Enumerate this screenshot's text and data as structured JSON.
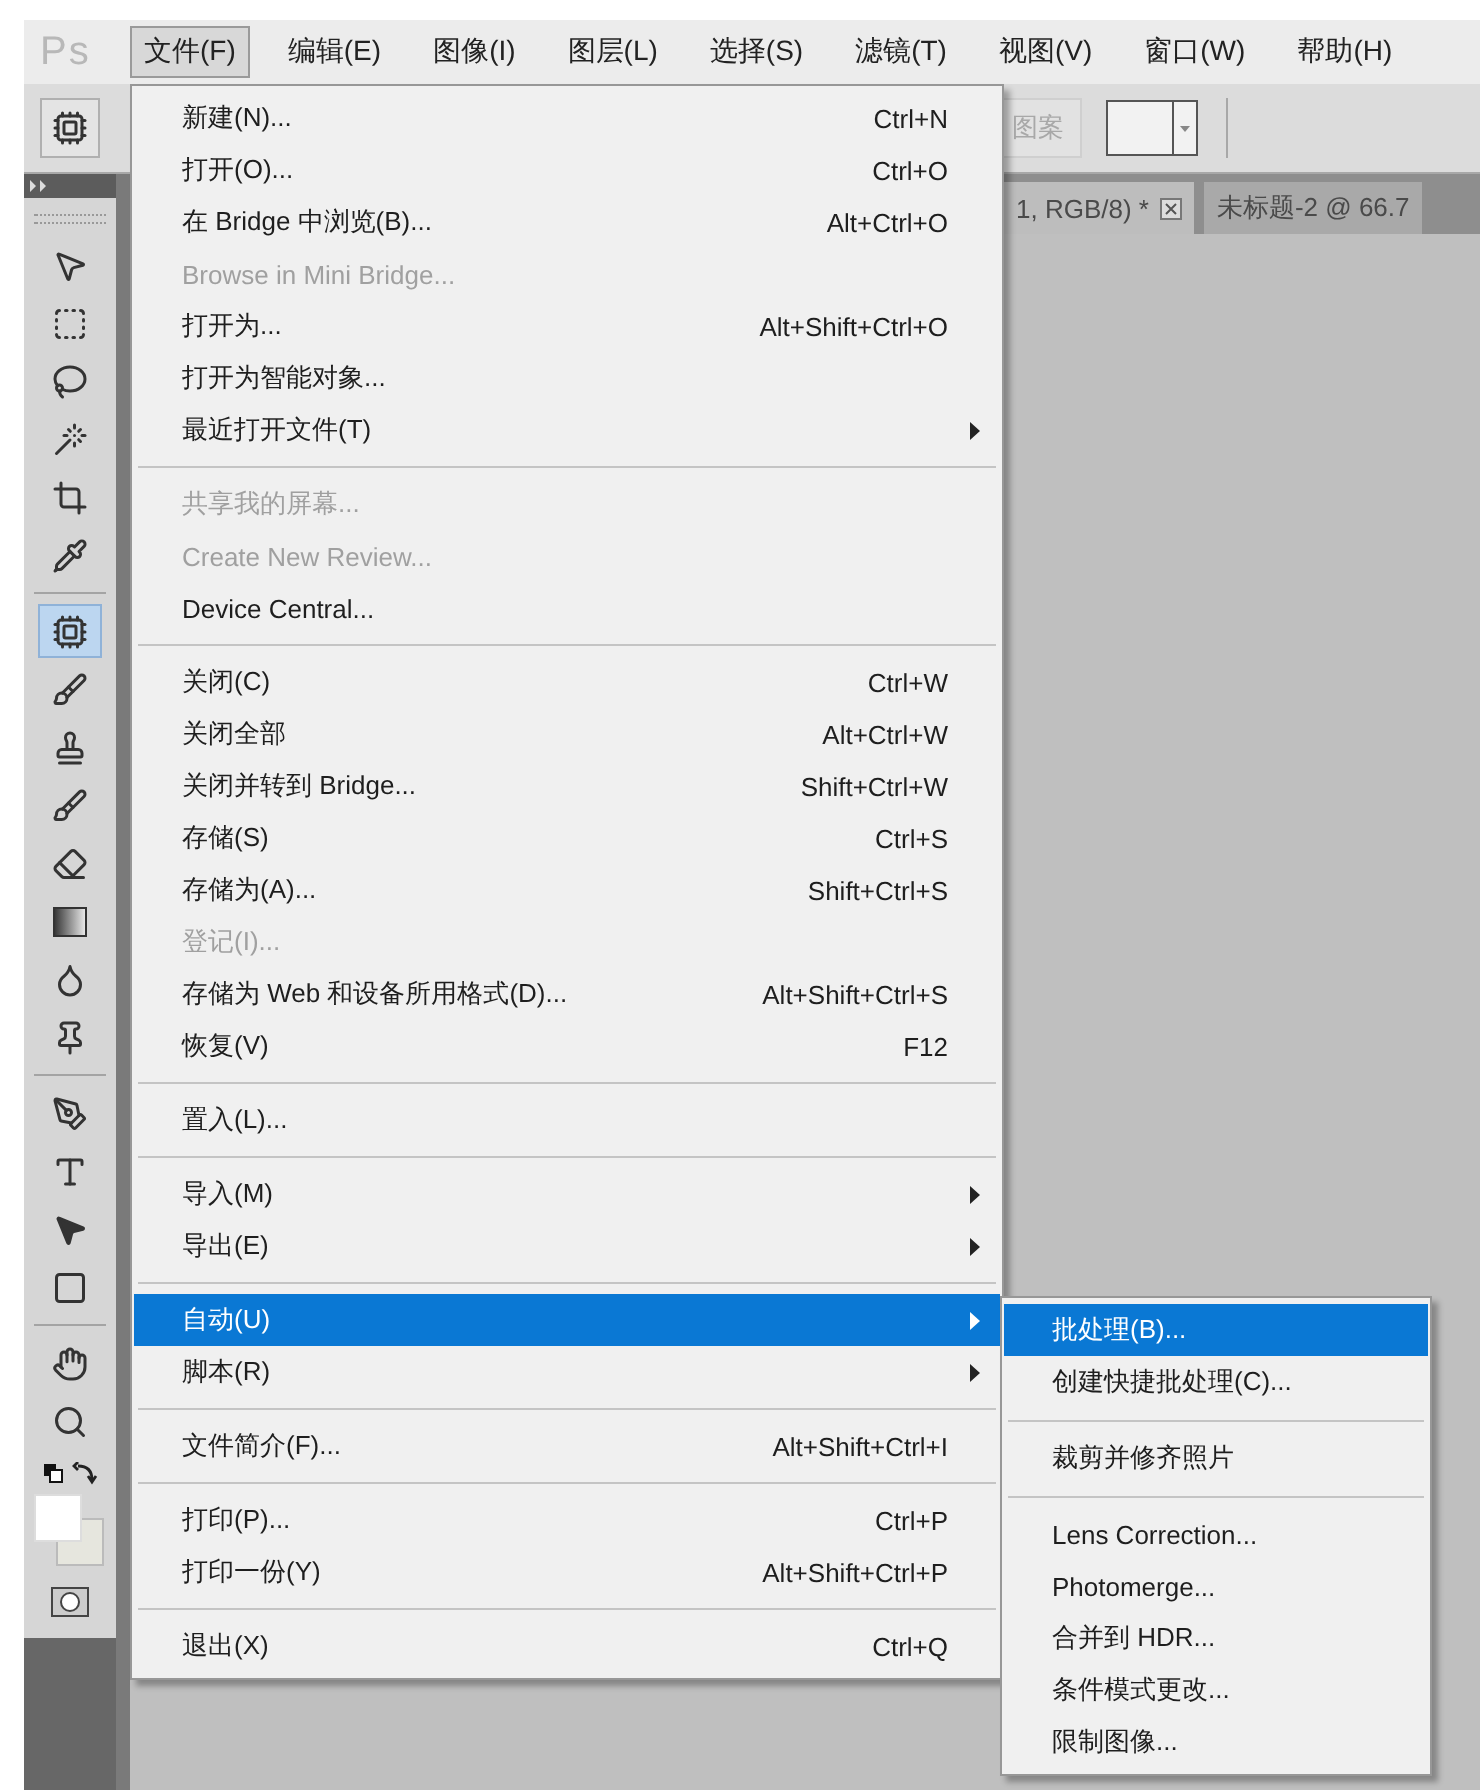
{
  "app": {
    "logo": "Ps"
  },
  "menubar": [
    {
      "label": "文件(F)",
      "selected": true
    },
    {
      "label": "编辑(E)",
      "selected": false
    },
    {
      "label": "图像(I)",
      "selected": false
    },
    {
      "label": "图层(L)",
      "selected": false
    },
    {
      "label": "选择(S)",
      "selected": false
    },
    {
      "label": "滤镜(T)",
      "selected": false
    },
    {
      "label": "视图(V)",
      "selected": false
    },
    {
      "label": "窗口(W)",
      "selected": false
    },
    {
      "label": "帮助(H)",
      "selected": false
    }
  ],
  "options_bar": {
    "pattern_button": {
      "label": "图案",
      "disabled": true
    }
  },
  "document_tabs": [
    {
      "label": "1, RGB/8) *",
      "closable": true
    },
    {
      "label": "未标题-2 @ 66.7",
      "closable": false
    }
  ],
  "tools": [
    {
      "selected": false
    },
    {
      "selected": false
    },
    {
      "selected": false
    },
    {
      "selected": false
    },
    {
      "selected": false
    },
    {
      "selected": false
    },
    {
      "selected": true
    },
    {
      "selected": false
    },
    {
      "selected": false
    },
    {
      "selected": false
    },
    {
      "selected": false
    },
    {
      "selected": false
    },
    {
      "selected": false
    },
    {
      "selected": false
    },
    {
      "selected": false
    },
    {
      "selected": false
    },
    {
      "selected": false
    },
    {
      "selected": false
    },
    {
      "selected": false
    },
    {
      "selected": false
    }
  ],
  "file_menu": {
    "items": [
      {
        "kind": "item",
        "label": "新建(N)...",
        "shortcut": "Ctrl+N",
        "disabled": false,
        "submenu": false,
        "selected": false
      },
      {
        "kind": "item",
        "label": "打开(O)...",
        "shortcut": "Ctrl+O",
        "disabled": false,
        "submenu": false,
        "selected": false
      },
      {
        "kind": "item",
        "label": "在 Bridge 中浏览(B)...",
        "shortcut": "Alt+Ctrl+O",
        "disabled": false,
        "submenu": false,
        "selected": false
      },
      {
        "kind": "item",
        "label": "Browse in Mini Bridge...",
        "disabled": true,
        "submenu": false,
        "selected": false
      },
      {
        "kind": "item",
        "label": "打开为...",
        "shortcut": "Alt+Shift+Ctrl+O",
        "disabled": false,
        "submenu": false,
        "selected": false
      },
      {
        "kind": "item",
        "label": "打开为智能对象...",
        "disabled": false,
        "submenu": false,
        "selected": false
      },
      {
        "kind": "item",
        "label": "最近打开文件(T)",
        "disabled": false,
        "submenu": true,
        "selected": false
      },
      {
        "kind": "separator"
      },
      {
        "kind": "item",
        "label": "共享我的屏幕...",
        "disabled": true,
        "submenu": false,
        "selected": false
      },
      {
        "kind": "item",
        "label": "Create New Review...",
        "disabled": true,
        "submenu": false,
        "selected": false
      },
      {
        "kind": "item",
        "label": "Device Central...",
        "disabled": false,
        "submenu": false,
        "selected": false
      },
      {
        "kind": "separator"
      },
      {
        "kind": "item",
        "label": "关闭(C)",
        "shortcut": "Ctrl+W",
        "disabled": false,
        "submenu": false,
        "selected": false
      },
      {
        "kind": "item",
        "label": "关闭全部",
        "shortcut": "Alt+Ctrl+W",
        "disabled": false,
        "submenu": false,
        "selected": false
      },
      {
        "kind": "item",
        "label": "关闭并转到 Bridge...",
        "shortcut": "Shift+Ctrl+W",
        "disabled": false,
        "submenu": false,
        "selected": false
      },
      {
        "kind": "item",
        "label": "存储(S)",
        "shortcut": "Ctrl+S",
        "disabled": false,
        "submenu": false,
        "selected": false
      },
      {
        "kind": "item",
        "label": "存储为(A)...",
        "shortcut": "Shift+Ctrl+S",
        "disabled": false,
        "submenu": false,
        "selected": false
      },
      {
        "kind": "item",
        "label": "登记(I)...",
        "disabled": true,
        "submenu": false,
        "selected": false
      },
      {
        "kind": "item",
        "label": "存储为 Web 和设备所用格式(D)...",
        "shortcut": "Alt+Shift+Ctrl+S",
        "disabled": false,
        "submenu": false,
        "selected": false
      },
      {
        "kind": "item",
        "label": "恢复(V)",
        "shortcut": "F12",
        "disabled": false,
        "submenu": false,
        "selected": false
      },
      {
        "kind": "separator"
      },
      {
        "kind": "item",
        "label": "置入(L)...",
        "disabled": false,
        "submenu": false,
        "selected": false
      },
      {
        "kind": "separator"
      },
      {
        "kind": "item",
        "label": "导入(M)",
        "disabled": false,
        "submenu": true,
        "selected": false
      },
      {
        "kind": "item",
        "label": "导出(E)",
        "disabled": false,
        "submenu": true,
        "selected": false
      },
      {
        "kind": "separator"
      },
      {
        "kind": "item",
        "label": "自动(U)",
        "disabled": false,
        "submenu": true,
        "selected": true
      },
      {
        "kind": "item",
        "label": "脚本(R)",
        "disabled": false,
        "submenu": true,
        "selected": false
      },
      {
        "kind": "separator"
      },
      {
        "kind": "item",
        "label": "文件简介(F)...",
        "shortcut": "Alt+Shift+Ctrl+I",
        "disabled": false,
        "submenu": false,
        "selected": false
      },
      {
        "kind": "separator"
      },
      {
        "kind": "item",
        "label": "打印(P)...",
        "shortcut": "Ctrl+P",
        "disabled": false,
        "submenu": false,
        "selected": false
      },
      {
        "kind": "item",
        "label": "打印一份(Y)",
        "shortcut": "Alt+Shift+Ctrl+P",
        "disabled": false,
        "submenu": false,
        "selected": false
      },
      {
        "kind": "separator"
      },
      {
        "kind": "item",
        "label": "退出(X)",
        "shortcut": "Ctrl+Q",
        "disabled": false,
        "submenu": false,
        "selected": false
      }
    ]
  },
  "automate_submenu": {
    "items": [
      {
        "kind": "item",
        "label": "批处理(B)...",
        "selected": true
      },
      {
        "kind": "item",
        "label": "创建快捷批处理(C)...",
        "selected": false
      },
      {
        "kind": "separator"
      },
      {
        "kind": "item",
        "label": "裁剪并修齐照片",
        "selected": false
      },
      {
        "kind": "separator"
      },
      {
        "kind": "item",
        "label": "Lens Correction...",
        "selected": false
      },
      {
        "kind": "item",
        "label": "Photomerge...",
        "selected": false
      },
      {
        "kind": "item",
        "label": "合并到 HDR...",
        "selected": false
      },
      {
        "kind": "item",
        "label": "条件模式更改...",
        "selected": false
      },
      {
        "kind": "item",
        "label": "限制图像...",
        "selected": false
      }
    ]
  }
}
